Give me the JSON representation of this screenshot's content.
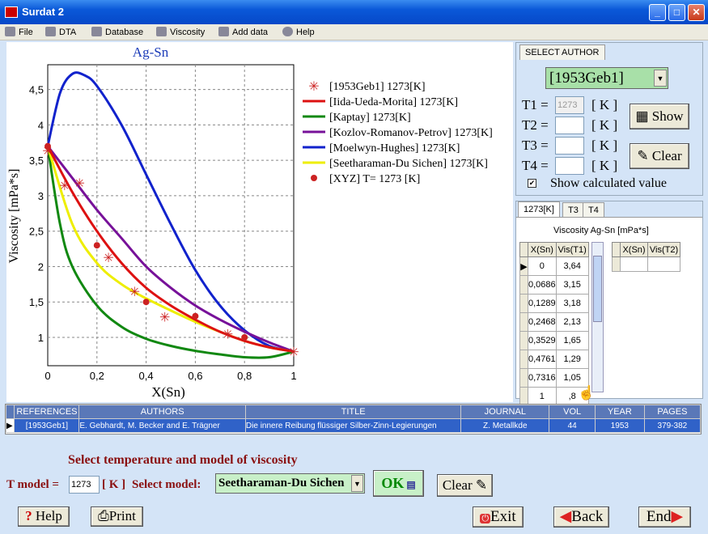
{
  "window": {
    "title": "Surdat 2"
  },
  "menu": [
    {
      "label": "File",
      "icon": "file-icon"
    },
    {
      "label": "DTA",
      "icon": "dta-icon"
    },
    {
      "label": "Database",
      "icon": "database-icon"
    },
    {
      "label": "Viscosity",
      "icon": "viscosity-icon"
    },
    {
      "label": "Add data",
      "icon": "add-data-icon"
    },
    {
      "label": "Help",
      "icon": "help-icon"
    }
  ],
  "chart_data": {
    "type": "line",
    "title": "Ag-Sn",
    "xlabel": "X(Sn)",
    "ylabel": "Viscosity [mPa*s]",
    "xlim": [
      0,
      1
    ],
    "ylim": [
      0.6,
      4.85
    ],
    "xticks": [
      "0",
      "0,2",
      "0,4",
      "0,6",
      "0,8",
      "1"
    ],
    "yticks": [
      "1",
      "1,5",
      "2",
      "2,5",
      "3",
      "3,5",
      "4",
      "4,5"
    ],
    "grid": true,
    "legend": "top-right",
    "series": [
      {
        "name": "[1953Geb1] 1273[K]",
        "kind": "star",
        "color": "#cc2222",
        "x": [
          0,
          0.0686,
          0.1289,
          0.2468,
          0.3529,
          0.4761,
          0.7316,
          1
        ],
        "y": [
          3.64,
          3.15,
          3.18,
          2.13,
          1.65,
          1.29,
          1.05,
          0.8
        ]
      },
      {
        "name": "[Iida-Ueda-Morita] 1273[K]",
        "kind": "line",
        "color": "#dd1111",
        "x": [
          0,
          0.1,
          0.2,
          0.3,
          0.4,
          0.5,
          0.6,
          0.7,
          0.8,
          0.9,
          1
        ],
        "y": [
          3.7,
          3.05,
          2.5,
          2.05,
          1.7,
          1.45,
          1.25,
          1.08,
          0.95,
          0.86,
          0.8
        ]
      },
      {
        "name": "[Kaptay] 1273[K]",
        "kind": "line",
        "color": "#118811",
        "x": [
          0,
          0.05,
          0.1,
          0.2,
          0.3,
          0.4,
          0.5,
          0.6,
          0.7,
          0.8,
          0.9,
          1
        ],
        "y": [
          3.7,
          2.6,
          2.0,
          1.45,
          1.15,
          0.98,
          0.88,
          0.81,
          0.76,
          0.72,
          0.72,
          0.8
        ]
      },
      {
        "name": "[Kozlov-Romanov-Petrov] 1273[K]",
        "kind": "line",
        "color": "#771199",
        "x": [
          0,
          0.1,
          0.2,
          0.3,
          0.4,
          0.5,
          0.6,
          0.7,
          0.8,
          0.9,
          1
        ],
        "y": [
          3.7,
          3.25,
          2.8,
          2.4,
          2.0,
          1.7,
          1.45,
          1.25,
          1.08,
          0.93,
          0.8
        ]
      },
      {
        "name": "[Moelwyn-Hughes] 1273[K]",
        "kind": "line",
        "color": "#1122cc",
        "x": [
          0,
          0.05,
          0.1,
          0.15,
          0.2,
          0.3,
          0.4,
          0.5,
          0.6,
          0.7,
          0.8,
          0.9,
          1
        ],
        "y": [
          3.7,
          4.45,
          4.72,
          4.7,
          4.55,
          4.0,
          3.3,
          2.6,
          1.95,
          1.45,
          1.1,
          0.88,
          0.8
        ]
      },
      {
        "name": "[Seetharaman-Du Sichen] 1273[K]",
        "kind": "line",
        "color": "#eeee00",
        "x": [
          0,
          0.1,
          0.2,
          0.3,
          0.4,
          0.5,
          0.6,
          0.7,
          0.8,
          0.9,
          1
        ],
        "y": [
          3.7,
          2.6,
          2.05,
          1.75,
          1.55,
          1.38,
          1.22,
          1.08,
          0.95,
          0.86,
          0.8
        ]
      },
      {
        "name": "[XYZ]  T= 1273 [K]",
        "kind": "dot",
        "color": "#cc2222",
        "x": [
          0,
          0.2,
          0.4,
          0.6,
          0.8
        ],
        "y": [
          3.7,
          2.3,
          1.5,
          1.3,
          1.0
        ]
      }
    ]
  },
  "author_panel": {
    "tab": "SELECT AUTHOR",
    "author": "[1953Geb1]",
    "t_labels": [
      "T1 =",
      "T2 =",
      "T3 =",
      "T4 ="
    ],
    "t_values": [
      "1273",
      "",
      "",
      ""
    ],
    "unit": "[ K ]",
    "show": "Show",
    "clear": "Clear",
    "show_calc": "Show calculated value"
  },
  "grid_panel": {
    "tabs": [
      "1273[K]",
      "T3",
      "T4"
    ],
    "caption": "Viscosity  Ag-Sn [mPa*s]",
    "headers": [
      "X(Sn)",
      "Vis(T1)"
    ],
    "headers2": [
      "X(Sn)",
      "Vis(T2)"
    ],
    "rows": [
      [
        "0",
        "3,64"
      ],
      [
        "0,0686",
        "3,15"
      ],
      [
        "0,1289",
        "3,18"
      ],
      [
        "0,2468",
        "2,13"
      ],
      [
        "0,3529",
        "1,65"
      ],
      [
        "0,4761",
        "1,29"
      ],
      [
        "0,7316",
        "1,05"
      ],
      [
        "1",
        ",8"
      ]
    ]
  },
  "references": {
    "headers": [
      "REFERENCES",
      "AUTHORS",
      "TITLE",
      "JOURNAL",
      "VOL",
      "YEAR",
      "PAGES"
    ],
    "row": [
      "[1953Geb1]",
      "E. Gebhardt, M. Becker and E. Trägner",
      "Die innere Reibung flüssiger Silber-Zinn-Legierungen",
      "Z. Metallkde",
      "44",
      "1953",
      "379-382"
    ]
  },
  "bottom": {
    "heading": "Select temperature and model of viscosity",
    "t_model": "T model =",
    "t_value": "1273",
    "unit": "[ K ]",
    "select_model": "Select model:",
    "model": "Seetharaman-Du Sichen",
    "ok": "OK",
    "clear": "Clear",
    "help": "Help",
    "print": "Print",
    "exit": "Exit",
    "back": "Back",
    "end": "End"
  }
}
